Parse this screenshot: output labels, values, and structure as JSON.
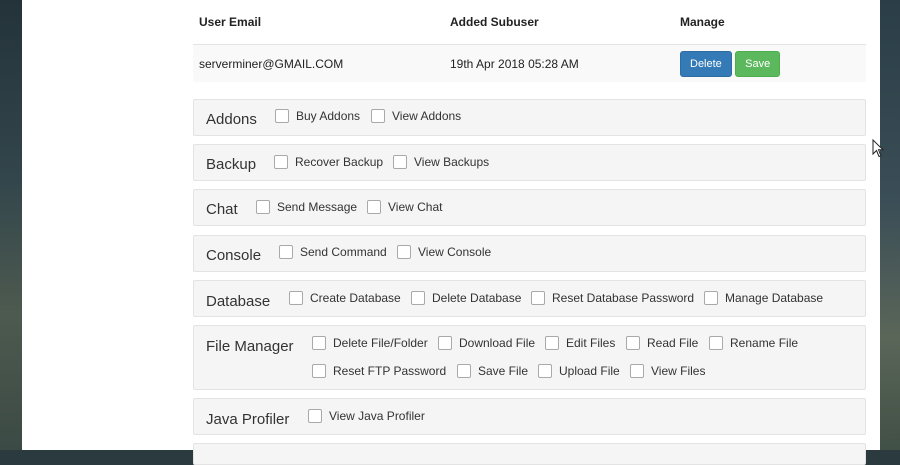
{
  "table": {
    "headers": [
      "User Email",
      "Added Subuser",
      "Manage"
    ],
    "row": {
      "email": "serverminer@GMAIL.COM",
      "added": "19th Apr 2018 05:28 AM",
      "delete_label": "Delete",
      "save_label": "Save"
    }
  },
  "groups": [
    {
      "title": "Addons",
      "options": [
        "Buy Addons",
        "View Addons"
      ]
    },
    {
      "title": "Backup",
      "options": [
        "Recover Backup",
        "View Backups"
      ]
    },
    {
      "title": "Chat",
      "options": [
        "Send Message",
        "View Chat"
      ]
    },
    {
      "title": "Console",
      "options": [
        "Send Command",
        "View Console"
      ]
    },
    {
      "title": "Database",
      "options": [
        "Create Database",
        "Delete Database",
        "Reset Database Password",
        "Manage Database"
      ]
    },
    {
      "title": "File Manager",
      "options": [
        "Delete File/Folder",
        "Download File",
        "Edit Files",
        "Read File",
        "Rename File",
        "Reset FTP Password",
        "Save File",
        "Upload File",
        "View Files"
      ]
    },
    {
      "title": "Java Profiler",
      "options": [
        "View Java Profiler"
      ]
    }
  ],
  "colors": {
    "delete": "#337ab7",
    "save": "#5cb85c"
  }
}
